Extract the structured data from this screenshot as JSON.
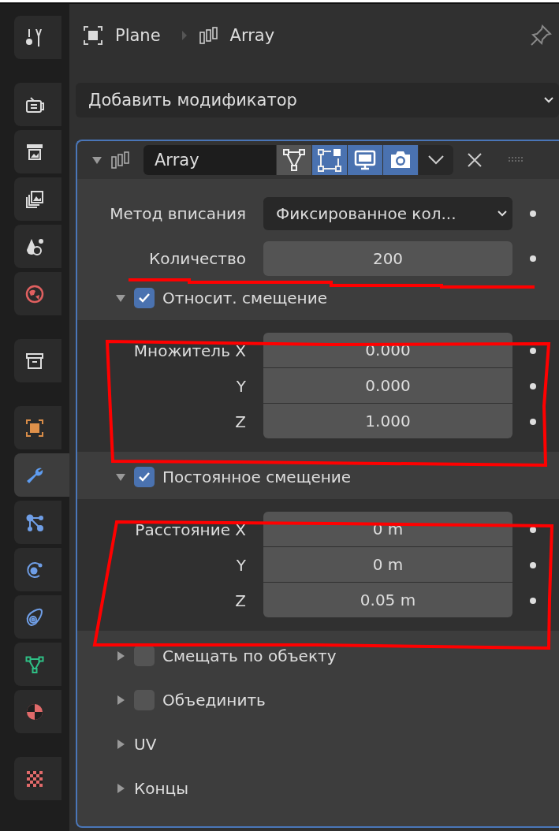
{
  "sidebar": {
    "groups": [
      [
        {
          "kind": "tool",
          "selected": false
        }
      ],
      [
        {
          "kind": "render",
          "selected": false
        },
        {
          "kind": "output",
          "selected": false
        },
        {
          "kind": "view-layer",
          "selected": false
        },
        {
          "kind": "scene",
          "selected": false
        },
        {
          "kind": "world",
          "selected": false
        }
      ],
      [
        {
          "kind": "collection",
          "selected": false
        }
      ],
      [
        {
          "kind": "object",
          "selected": false
        },
        {
          "kind": "modifier",
          "selected": true
        },
        {
          "kind": "particles",
          "selected": false
        },
        {
          "kind": "physics",
          "selected": false
        },
        {
          "kind": "constraints",
          "selected": false
        },
        {
          "kind": "data",
          "selected": false
        },
        {
          "kind": "material",
          "selected": false
        }
      ],
      [
        {
          "kind": "texture",
          "selected": false
        }
      ]
    ]
  },
  "breadcrumb": [
    {
      "kind": "object",
      "text": "Plane"
    },
    {
      "kind": "array",
      "text": "Array"
    }
  ],
  "add_modifier": "Добавить модификатор",
  "modifier": {
    "name": "Array",
    "expanded": true,
    "toggles": [
      {
        "kind": "edit-mode",
        "on": false
      },
      {
        "kind": "cage",
        "on": true
      },
      {
        "kind": "viewport",
        "on": true
      },
      {
        "kind": "render",
        "on": true
      }
    ],
    "fit_method": {
      "label": "Метод вписания",
      "value": "Фиксированное кол..."
    },
    "count": {
      "label": "Количество",
      "value": "200"
    },
    "subpanels": [
      {
        "kind": "checkbox",
        "label": "Относит. смещение",
        "expanded": true,
        "checked": true,
        "rows": [
          {
            "label": "Множитель X",
            "value": "0.000"
          },
          {
            "label": "Y",
            "value": "0.000"
          },
          {
            "label": "Z",
            "value": "1.000"
          }
        ]
      },
      {
        "kind": "checkbox",
        "label": "Постоянное смещение",
        "expanded": true,
        "checked": true,
        "rows": [
          {
            "label": "Расстояние X",
            "value": "0 m"
          },
          {
            "label": "Y",
            "value": "0 m"
          },
          {
            "label": "Z",
            "value": "0.05 m"
          }
        ]
      },
      {
        "kind": "checkbox",
        "label": "Смещать по объекту",
        "expanded": false,
        "checked": false
      },
      {
        "kind": "checkbox",
        "label": "Объединить",
        "expanded": false,
        "checked": false
      },
      {
        "kind": "plain",
        "label": "UV",
        "expanded": false
      },
      {
        "kind": "plain",
        "label": "Концы",
        "expanded": false
      }
    ]
  }
}
